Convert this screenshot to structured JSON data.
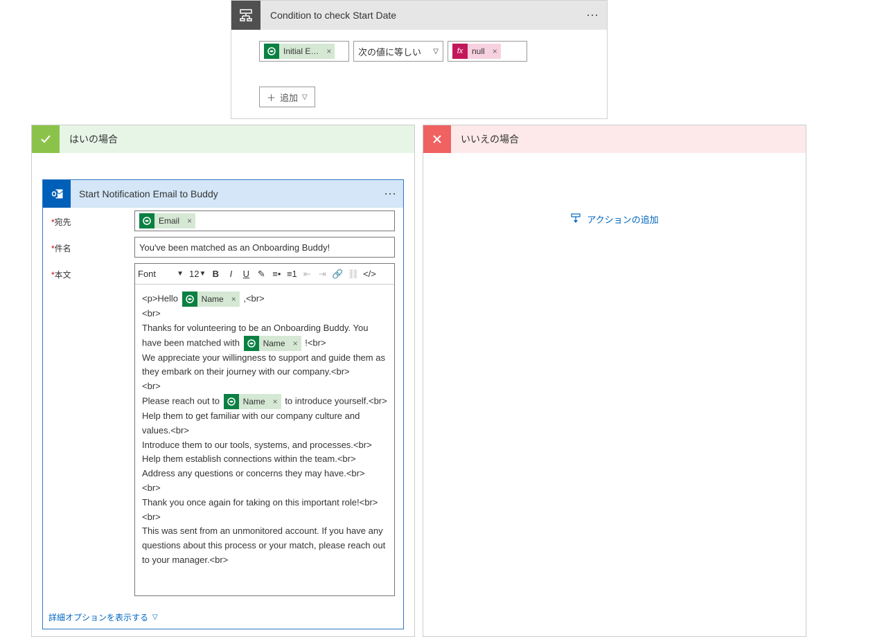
{
  "condition": {
    "title": "Condition to check Start Date",
    "left_token": "Initial E…",
    "operator": "次の値に等しい",
    "right_token": "null",
    "add": "追加"
  },
  "yes": {
    "label": "はいの場合"
  },
  "no": {
    "label": "いいえの場合",
    "add_action": "アクションの追加"
  },
  "email": {
    "title": "Start Notification Email to Buddy",
    "to_label": "宛先",
    "to_token": "Email",
    "subject_label": "件名",
    "subject": "You've been matched as an Onboarding Buddy!",
    "body_label": "本文",
    "font": "Font",
    "fontsize": "12",
    "body": {
      "l1a": "<p>Hello",
      "l1b": ",<br>",
      "l2": "<br>",
      "l3a": "Thanks for volunteering to be an Onboarding Buddy. You have been matched with",
      "l3b": "!<br>",
      "l4": "We appreciate your willingness to support and guide them as they embark on their journey with our company.<br>",
      "l5": "<br>",
      "l6a": "Please reach out to",
      "l6b": "to introduce yourself.<br>",
      "l7": "Help them to get familiar with our company culture and values.<br>",
      "l8": "Introduce them to our tools, systems, and processes.<br>",
      "l9": "Help them establish connections within the team.<br>",
      "l10": "Address any questions or concerns they may have.<br>",
      "l11": "<br>",
      "l12": "Thank you once again for taking on this important role!<br>",
      "l13": "<br>",
      "l14": "This was sent from an unmonitored account. If you have any questions about this process or your match, please reach out to your manager.<br>",
      "name_token": "Name"
    },
    "show_advanced": "詳細オプションを表示する"
  }
}
